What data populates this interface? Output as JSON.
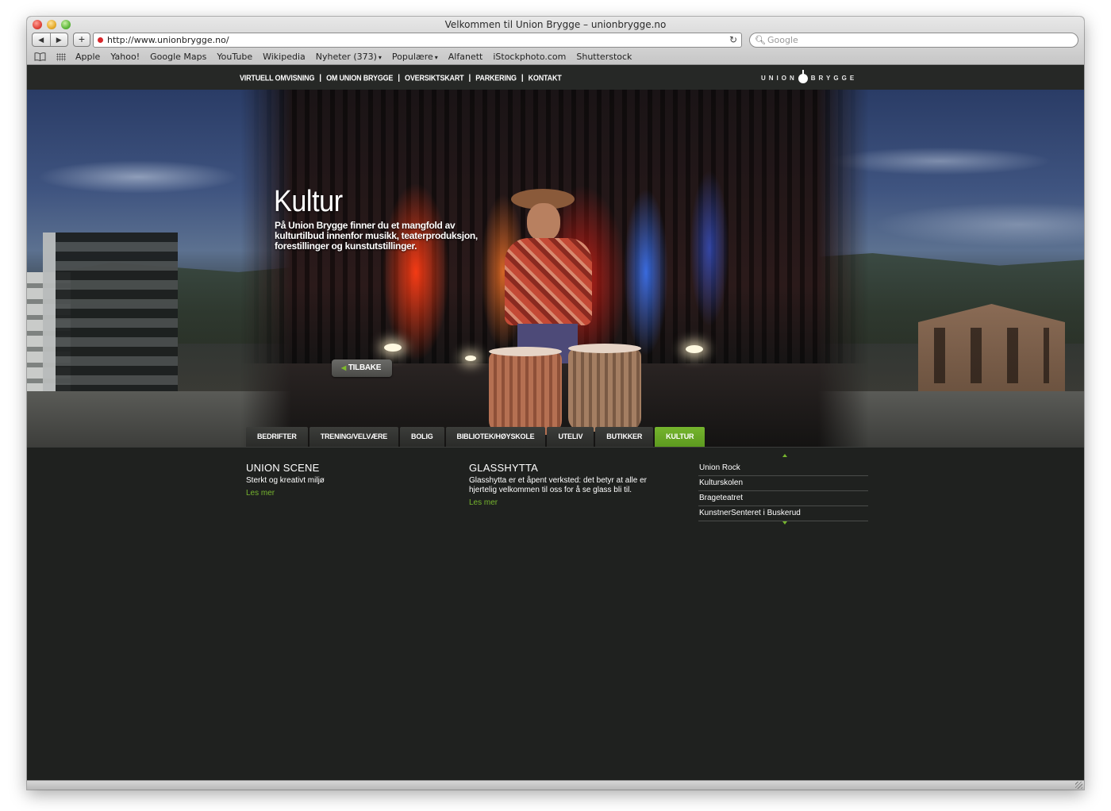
{
  "browser": {
    "window_title": "Velkommen til Union Brygge – unionbrygge.no",
    "url": "http://www.unionbrygge.no/",
    "search_placeholder": "Google",
    "bookmarks": [
      {
        "label": "Apple",
        "dropdown": false
      },
      {
        "label": "Yahoo!",
        "dropdown": false
      },
      {
        "label": "Google Maps",
        "dropdown": false
      },
      {
        "label": "YouTube",
        "dropdown": false
      },
      {
        "label": "Wikipedia",
        "dropdown": false
      },
      {
        "label": "Nyheter (373)",
        "dropdown": true
      },
      {
        "label": "Populære",
        "dropdown": true
      },
      {
        "label": "Alfanett",
        "dropdown": false
      },
      {
        "label": "iStockphoto.com",
        "dropdown": false
      },
      {
        "label": "Shutterstock",
        "dropdown": false
      }
    ]
  },
  "site": {
    "topnav": [
      "VIRTUELL OMVISNING",
      "OM UNION BRYGGE",
      "OVERSIKTSKART",
      "PARKERING",
      "KONTAKT"
    ],
    "logo": {
      "left": "UNION",
      "right": "BRYGGE"
    },
    "hero": {
      "title": "Kultur",
      "text": "På Union Brygge finner du et mangfold av kulturtilbud innenfor musikk, teaterproduksjon, forestillinger og kunstutstillinger.",
      "back_label": "TILBAKE"
    },
    "categories": [
      {
        "label": "BEDRIFTER",
        "active": false
      },
      {
        "label": "TRENING/VELVÆRE",
        "active": false
      },
      {
        "label": "BOLIG",
        "active": false
      },
      {
        "label": "BIBLIOTEK/HØYSKOLE",
        "active": false
      },
      {
        "label": "UTELIV",
        "active": false
      },
      {
        "label": "BUTIKKER",
        "active": false
      },
      {
        "label": "KULTUR",
        "active": true
      }
    ],
    "content": {
      "col1": {
        "heading": "UNION SCENE",
        "text": "Sterkt og kreativt miljø",
        "more": "Les mer"
      },
      "col2": {
        "heading": "GLASSHYTTA",
        "text": "Glasshytta er et åpent verksted: det betyr at alle er hjertelig velkommen til oss for å se glass bli til.",
        "more": "Les mer"
      },
      "side_list": [
        "Union Rock",
        "Kulturskolen",
        "Brageteatret",
        "KunstnerSenteret i Buskerud"
      ]
    }
  },
  "colors": {
    "accent_green": "#76b52e",
    "background": "#1f211f"
  }
}
